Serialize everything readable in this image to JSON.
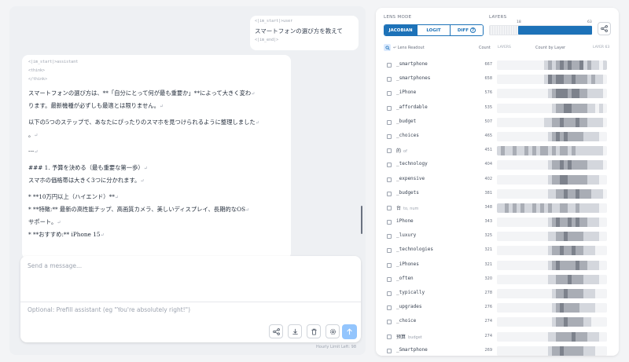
{
  "chat": {
    "user": {
      "start_token": "<|im_start|>user",
      "text": "スマートフォンの選び方を教えて",
      "end_token": "<|im_end|>"
    },
    "assistant": {
      "start_token": "<|im_start|>assistant",
      "think_open": "<think>",
      "think_close": "</think>",
      "lines": [
        "スマートフォンの選び方は、**「自分にとって何が最も重要か」**によって大きく変わ",
        "ります。最新機種が必ずしも最適とは限りません。",
        "",
        "以下の5つのステップで、あなたにぴったりのスマホを見つけられるように整理しました",
        "。",
        "",
        "---",
        "",
        "### 1. 予算を決める（最も重要な第一歩）",
        "スマホの価格帯は大きく3つに分かれます。",
        "",
        "*   **10万円以上（ハイエンド）**",
        "    *   **特徴:** 最新の高性能チップ、高画質カメラ、美しいディスプレイ、長期的なOS",
        "サポート。",
        "    *   **おすすめ:** iPhone 15"
      ],
      "return_mark": "↵"
    },
    "message_placeholder": "Send a message...",
    "prefill_placeholder": "Optional: Prefill assistant (eg \"You're absolutely right!\")",
    "hourly_limit": "Hourly Limit Left: 98",
    "toolbar_icons": [
      "share-icon",
      "download-icon",
      "trash-icon",
      "settings-icon"
    ],
    "send_icon": "arrow-up-icon"
  },
  "lens": {
    "mode_label": "LENS MODE",
    "modes": [
      "JACOBIAN",
      "LOGIT",
      "DIFF"
    ],
    "active_mode": "JACOBIAN",
    "layers_label": "LAYERS",
    "layer_start": "18",
    "layer_end": "63",
    "header": {
      "readout": "↵ Lens Readout",
      "count": "Count",
      "layers_left": "LAYERS",
      "count_by_layer": "Count by Layer",
      "layers_right": "LAYER 63"
    },
    "accent": "#1d72b8",
    "rows": [
      {
        "token": "_smartphone",
        "trans": "",
        "count": "667",
        "heat": [
          0,
          0,
          0,
          0,
          0,
          0,
          0,
          0,
          0,
          0,
          0,
          0,
          1,
          2,
          1,
          2,
          3,
          2,
          3,
          2,
          2,
          3,
          1,
          2,
          1,
          1,
          0,
          1
        ]
      },
      {
        "token": "_smartphones",
        "trans": "",
        "count": "658",
        "heat": [
          0,
          0,
          0,
          0,
          0,
          0,
          0,
          0,
          0,
          0,
          0,
          0,
          1,
          3,
          2,
          3,
          3,
          2,
          2,
          3,
          2,
          2,
          2,
          1,
          2,
          1,
          1,
          0
        ]
      },
      {
        "token": "_iPhone",
        "trans": "",
        "count": "576",
        "heat": [
          0,
          0,
          0,
          0,
          0,
          0,
          0,
          0,
          0,
          0,
          0,
          0,
          0,
          1,
          2,
          3,
          3,
          3,
          2,
          3,
          3,
          2,
          2,
          1,
          1,
          1,
          1,
          0
        ]
      },
      {
        "token": "_affordable",
        "trans": "",
        "count": "535",
        "heat": [
          0,
          0,
          0,
          0,
          0,
          0,
          0,
          0,
          0,
          0,
          0,
          0,
          0,
          0,
          1,
          2,
          2,
          3,
          3,
          2,
          2,
          2,
          2,
          1,
          1,
          0,
          1,
          0
        ]
      },
      {
        "token": "_budget",
        "trans": "",
        "count": "507",
        "heat": [
          0,
          0,
          0,
          0,
          0,
          0,
          0,
          0,
          0,
          0,
          0,
          0,
          1,
          1,
          2,
          2,
          3,
          2,
          2,
          2,
          3,
          2,
          2,
          1,
          1,
          1,
          1,
          0
        ]
      },
      {
        "token": "_choices",
        "trans": "",
        "count": "465",
        "heat": [
          0,
          0,
          0,
          0,
          0,
          0,
          0,
          0,
          0,
          0,
          0,
          0,
          0,
          1,
          2,
          3,
          2,
          3,
          2,
          2,
          2,
          2,
          1,
          1,
          1,
          1,
          0,
          0
        ]
      },
      {
        "token": "的",
        "trans": "of",
        "count": "451",
        "heat": [
          1,
          2,
          1,
          1,
          2,
          1,
          1,
          2,
          1,
          2,
          1,
          2,
          2,
          1,
          2,
          1,
          2,
          2,
          1,
          2,
          1,
          1,
          1,
          1,
          1,
          1,
          1,
          0
        ]
      },
      {
        "token": "_technology",
        "trans": "",
        "count": "404",
        "heat": [
          0,
          0,
          0,
          0,
          0,
          0,
          0,
          0,
          0,
          0,
          0,
          0,
          0,
          1,
          2,
          2,
          3,
          2,
          3,
          2,
          2,
          2,
          2,
          1,
          1,
          1,
          1,
          0
        ]
      },
      {
        "token": "_expensive",
        "trans": "",
        "count": "402",
        "heat": [
          0,
          0,
          0,
          0,
          0,
          0,
          0,
          0,
          0,
          0,
          0,
          0,
          0,
          1,
          2,
          2,
          3,
          3,
          2,
          2,
          2,
          2,
          2,
          1,
          1,
          1,
          0,
          0
        ]
      },
      {
        "token": "_budgets",
        "trans": "",
        "count": "381",
        "heat": [
          0,
          0,
          0,
          0,
          0,
          0,
          0,
          0,
          0,
          0,
          0,
          0,
          0,
          1,
          1,
          2,
          2,
          3,
          2,
          2,
          3,
          2,
          2,
          2,
          1,
          1,
          1,
          0
        ]
      },
      {
        "token": "台",
        "trans": "to, num",
        "count": "348",
        "heat": [
          1,
          1,
          2,
          1,
          2,
          1,
          2,
          1,
          1,
          2,
          1,
          2,
          1,
          2,
          1,
          1,
          2,
          2,
          1,
          1,
          2,
          1,
          1,
          1,
          1,
          1,
          0,
          0
        ]
      },
      {
        "token": "iPhone",
        "trans": "",
        "count": "343",
        "heat": [
          0,
          0,
          0,
          0,
          0,
          0,
          0,
          0,
          0,
          0,
          0,
          0,
          0,
          1,
          2,
          3,
          2,
          2,
          3,
          2,
          3,
          2,
          2,
          1,
          1,
          1,
          0,
          0
        ]
      },
      {
        "token": "_luxury",
        "trans": "",
        "count": "325",
        "heat": [
          0,
          0,
          0,
          0,
          0,
          0,
          0,
          0,
          0,
          0,
          0,
          0,
          0,
          1,
          1,
          2,
          2,
          3,
          2,
          2,
          2,
          2,
          1,
          1,
          1,
          1,
          0,
          0
        ]
      },
      {
        "token": "_technologies",
        "trans": "",
        "count": "321",
        "heat": [
          0,
          0,
          0,
          0,
          0,
          0,
          0,
          0,
          0,
          0,
          0,
          0,
          0,
          1,
          2,
          2,
          3,
          2,
          2,
          3,
          2,
          2,
          1,
          1,
          1,
          0,
          0,
          0
        ]
      },
      {
        "token": "_iPhones",
        "trans": "",
        "count": "321",
        "heat": [
          0,
          0,
          0,
          0,
          0,
          0,
          0,
          0,
          0,
          0,
          0,
          0,
          0,
          1,
          2,
          3,
          2,
          2,
          2,
          2,
          3,
          2,
          2,
          1,
          1,
          1,
          0,
          0
        ]
      },
      {
        "token": "_often",
        "trans": "",
        "count": "320",
        "heat": [
          0,
          0,
          0,
          0,
          0,
          0,
          0,
          0,
          0,
          0,
          0,
          0,
          0,
          1,
          1,
          2,
          2,
          2,
          3,
          2,
          2,
          2,
          1,
          1,
          1,
          1,
          0,
          0
        ]
      },
      {
        "token": "_typically",
        "trans": "",
        "count": "278",
        "heat": [
          0,
          0,
          0,
          0,
          0,
          0,
          0,
          0,
          0,
          0,
          0,
          0,
          0,
          0,
          1,
          2,
          2,
          3,
          2,
          2,
          2,
          2,
          1,
          1,
          1,
          0,
          0,
          0
        ]
      },
      {
        "token": "_upgrades",
        "trans": "",
        "count": "276",
        "heat": [
          0,
          0,
          0,
          0,
          0,
          0,
          0,
          0,
          0,
          0,
          0,
          0,
          0,
          0,
          1,
          2,
          3,
          2,
          2,
          2,
          2,
          1,
          1,
          1,
          1,
          0,
          0,
          0
        ]
      },
      {
        "token": "_choice",
        "trans": "",
        "count": "274",
        "heat": [
          0,
          0,
          0,
          0,
          0,
          0,
          0,
          0,
          0,
          0,
          0,
          0,
          0,
          0,
          1,
          2,
          2,
          3,
          2,
          2,
          2,
          2,
          1,
          1,
          0,
          0,
          0,
          0
        ]
      },
      {
        "token": "预算",
        "trans": "budget",
        "count": "274",
        "heat": [
          0,
          0,
          0,
          0,
          0,
          0,
          0,
          0,
          0,
          0,
          0,
          0,
          0,
          1,
          1,
          2,
          2,
          2,
          2,
          3,
          2,
          2,
          2,
          1,
          1,
          1,
          0,
          0
        ]
      },
      {
        "token": "_Smartphone",
        "trans": "",
        "count": "269",
        "heat": [
          0,
          0,
          0,
          0,
          0,
          0,
          0,
          0,
          0,
          0,
          0,
          0,
          0,
          1,
          2,
          2,
          3,
          2,
          2,
          2,
          2,
          2,
          1,
          1,
          1,
          0,
          0,
          0
        ]
      }
    ]
  }
}
